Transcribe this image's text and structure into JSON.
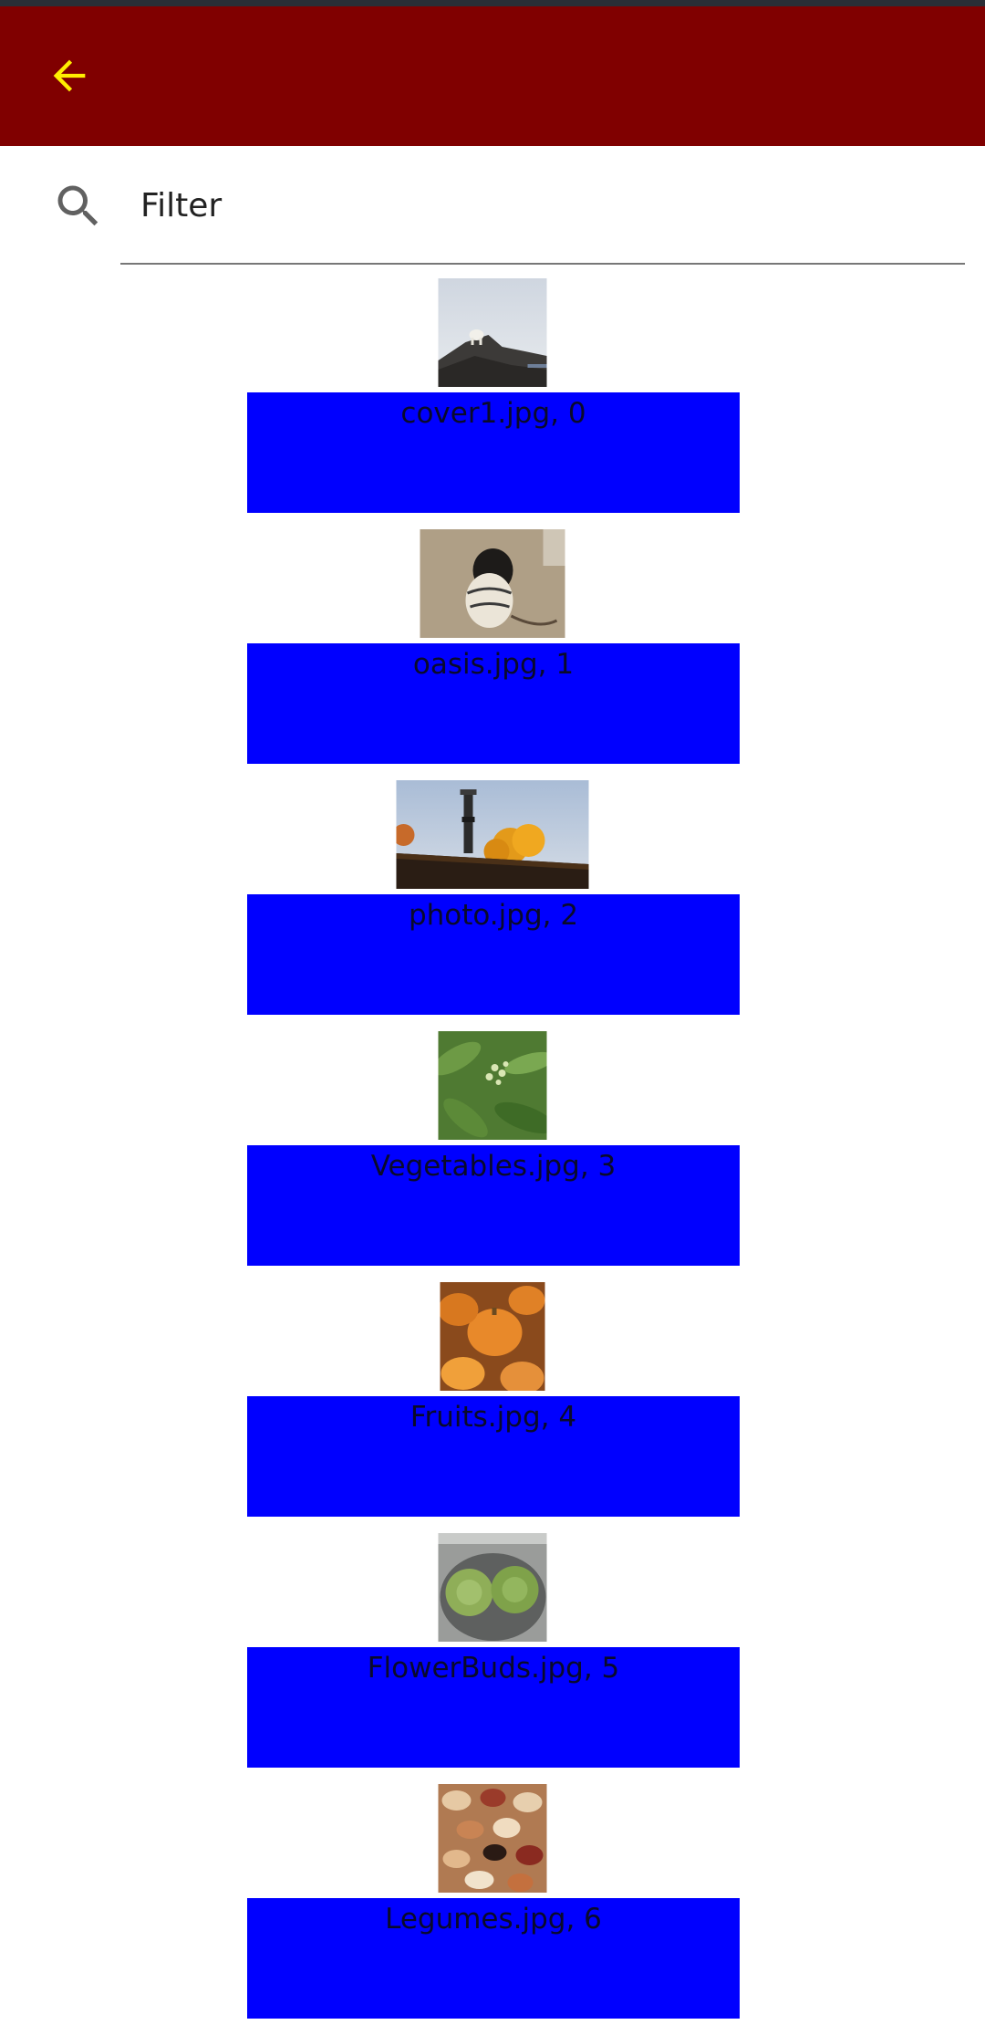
{
  "colors": {
    "status_bar": "#2a2e36",
    "app_bar": "#800000",
    "back_arrow": "#ffee00",
    "caption_background": "#0000ff",
    "search_icon": "#616161"
  },
  "app_bar": {
    "back_icon": "arrow-back-icon"
  },
  "filter": {
    "icon": "search-icon",
    "placeholder": "Filter",
    "value": ""
  },
  "items": [
    {
      "caption": "cover1.jpg, 0",
      "thumb": "goat-on-rocks"
    },
    {
      "caption": "oasis.jpg, 1",
      "thumb": "pug-in-sweater"
    },
    {
      "caption": "photo.jpg, 2",
      "thumb": "chimney-autumn-tree"
    },
    {
      "caption": "Vegetables.jpg, 3",
      "thumb": "green-plant"
    },
    {
      "caption": "Fruits.jpg, 4",
      "thumb": "pumpkins"
    },
    {
      "caption": "FlowerBuds.jpg, 5",
      "thumb": "artichokes"
    },
    {
      "caption": "Legumes.jpg, 6",
      "thumb": "beans"
    }
  ]
}
